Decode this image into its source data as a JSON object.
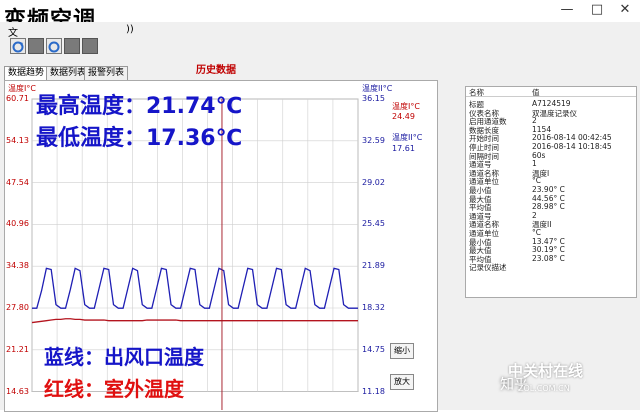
{
  "window": {
    "overlay_title": "变频空调",
    "menu_fragment": "文",
    "menu_fragment2": "))"
  },
  "tabs": [
    "数据趋势",
    "数据列表",
    "报警列表"
  ],
  "chart_title": "历史数据",
  "left_axis": {
    "label": "温度I°C",
    "ticks": [
      "60.71",
      "54.13",
      "47.54",
      "40.96",
      "34.38",
      "27.80",
      "21.21",
      "14.63"
    ],
    "color": "#c00000"
  },
  "right_axis": {
    "label": "温度II°C",
    "ticks": [
      "36.15",
      "32.59",
      "29.02",
      "25.45",
      "21.89",
      "18.32",
      "14.75",
      "11.18"
    ],
    "color": "#1a1aa0"
  },
  "legend_values": {
    "t1_label": "温度I°C",
    "t1_value": "24.49",
    "t2_label": "温度II°C",
    "t2_value": "17.61"
  },
  "buttons": {
    "zoom_out": "缩小",
    "zoom_in": "放大"
  },
  "overlay_text": {
    "max_temp": "最高温度：21.74℃",
    "min_temp": "最低温度：17.36℃",
    "blue_line": "蓝线：出风口温度",
    "red_line": "红线：室外温度"
  },
  "colors": {
    "blue_series": "#1f1fb4",
    "red_series": "#b4141e",
    "overlay_blue": "#1515c8",
    "overlay_red": "#e01010",
    "cursor": "#a0101e"
  },
  "info_table": {
    "headers": [
      "名称",
      "值"
    ],
    "rows": [
      [
        "标题",
        "A7124519"
      ],
      [
        "仪表名称",
        "双温度记录仪"
      ],
      [
        "启用通道数",
        "2"
      ],
      [
        "数据长度",
        "1154"
      ],
      [
        "开始时间",
        "2016-08-14 00:42:45"
      ],
      [
        "停止时间",
        "2016-08-14 10:18:45"
      ],
      [
        "间隔时间",
        "60s"
      ],
      [
        "通道号",
        "1"
      ],
      [
        "通道名称",
        "温度I"
      ],
      [
        "通道单位",
        "°C"
      ],
      [
        "最小值",
        "23.90° C"
      ],
      [
        "最大值",
        "44.56° C"
      ],
      [
        "平均值",
        "28.98° C"
      ],
      [
        "通道号",
        "2"
      ],
      [
        "通道名称",
        "温度II"
      ],
      [
        "通道单位",
        "°C"
      ],
      [
        "最小值",
        "13.47° C"
      ],
      [
        "最大值",
        "30.19° C"
      ],
      [
        "平均值",
        "23.08° C"
      ],
      [
        "记录仪描述",
        ""
      ]
    ]
  },
  "watermark": {
    "brand": "中关村在线",
    "site": "ZOL.COM.CN",
    "zhihu": "知乎"
  },
  "chart_data": {
    "type": "line",
    "title": "历史数据",
    "ylabel_left": "温度I°C",
    "ylabel_right": "温度II°C",
    "ylim_left": [
      14.63,
      60.71
    ],
    "ylim_right": [
      11.18,
      36.15
    ],
    "series": [
      {
        "name": "温度II°C",
        "axis": "right",
        "color": "#1f1fb4",
        "values": [
          18.3,
          18.3,
          19.8,
          21.7,
          21.6,
          18.6,
          18.3,
          18.3,
          19.9,
          21.7,
          21.5,
          18.6,
          18.3,
          18.3,
          20.0,
          21.7,
          21.6,
          18.6,
          18.3,
          18.3,
          20.0,
          21.7,
          21.5,
          18.6,
          18.3,
          18.3,
          20.0,
          21.7,
          21.6,
          18.6,
          18.3,
          18.3,
          20.0,
          21.7,
          21.6,
          18.6,
          18.3,
          18.3,
          20.0,
          21.7,
          21.5,
          18.6,
          18.3,
          18.3,
          20.0,
          21.7,
          21.6,
          18.6,
          18.3,
          18.3,
          20.0,
          21.7,
          21.6,
          18.6,
          18.3,
          18.3,
          20.0,
          21.7,
          21.5,
          18.6,
          18.3,
          18.3,
          20.0,
          21.7,
          21.6,
          18.6,
          18.3,
          18.3,
          18.3
        ]
      },
      {
        "name": "温度I°C",
        "axis": "left",
        "color": "#b4141e",
        "values": [
          25.5,
          25.6,
          25.7,
          25.8,
          25.9,
          26.0,
          26.0,
          26.1,
          26.1,
          26.0,
          26.0,
          25.9,
          25.9,
          25.9,
          25.9,
          25.9,
          25.8,
          25.8,
          25.8,
          25.8,
          25.8,
          25.8,
          25.8,
          25.8,
          25.9,
          25.9,
          25.9,
          25.9,
          25.9,
          25.9,
          25.9,
          25.8,
          25.8,
          25.8,
          25.8,
          25.8,
          25.8,
          25.8,
          25.8,
          25.8,
          25.8,
          25.8,
          25.8,
          25.8,
          25.8,
          25.8,
          25.8,
          25.8,
          25.8,
          25.8,
          25.8,
          25.8,
          25.8,
          25.8,
          25.8,
          25.8,
          25.8,
          25.8,
          25.8,
          25.8,
          25.8,
          25.8,
          25.8,
          25.8,
          25.8,
          25.8,
          25.8,
          25.8,
          25.8
        ]
      }
    ],
    "cursor_index": 39,
    "grid": true
  }
}
